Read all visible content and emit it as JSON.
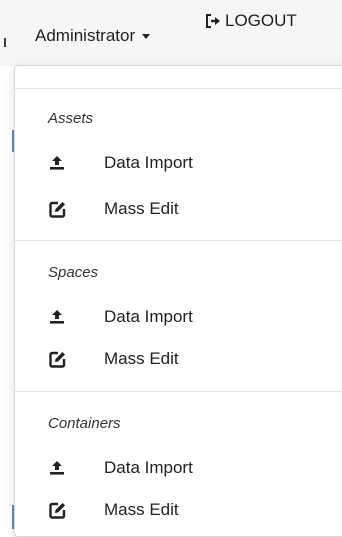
{
  "header": {
    "user_menu_label": "Administrator",
    "logout_label": "LOGOUT"
  },
  "menu": {
    "sections": [
      {
        "title": "Assets",
        "items": [
          {
            "label": "Data Import",
            "icon": "upload-icon"
          },
          {
            "label": "Mass Edit",
            "icon": "edit-icon"
          }
        ]
      },
      {
        "title": "Spaces",
        "items": [
          {
            "label": "Data Import",
            "icon": "upload-icon"
          },
          {
            "label": "Mass Edit",
            "icon": "edit-icon"
          }
        ]
      },
      {
        "title": "Containers",
        "items": [
          {
            "label": "Data Import",
            "icon": "upload-icon"
          },
          {
            "label": "Mass Edit",
            "icon": "edit-icon"
          }
        ]
      }
    ]
  }
}
